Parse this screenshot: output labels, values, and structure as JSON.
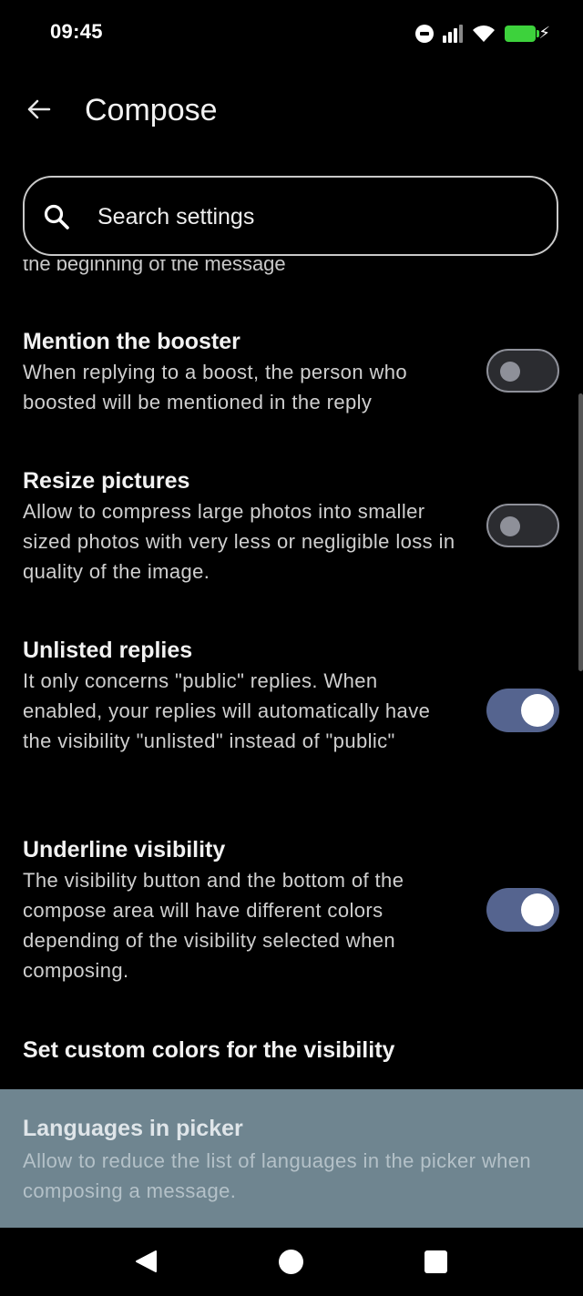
{
  "status_bar": {
    "time": "09:45"
  },
  "app_bar": {
    "title": "Compose"
  },
  "search": {
    "placeholder": "Search settings"
  },
  "clipped_previous_desc": "the beginning of the message",
  "settings": [
    {
      "title": "Mention the booster",
      "desc": "When replying to a boost, the person who boosted will be mentioned in the reply",
      "toggle": false
    },
    {
      "title": "Resize pictures",
      "desc": "Allow to compress large photos into smaller sized photos with very less or negligible loss in quality of the image.",
      "toggle": false
    },
    {
      "title": "Unlisted replies",
      "desc": "It only concerns \"public\" replies. When enabled, your replies will automatically have the visibility \"unlisted\" instead of \"public\"",
      "toggle": true
    },
    {
      "title": "Underline visibility",
      "desc": "The visibility button and the bottom of the compose area will have different colors depending of the visibility selected when composing.",
      "toggle": true
    },
    {
      "title": "Set custom colors for the visibility"
    },
    {
      "title": "Languages in picker",
      "desc": "Allow to reduce the list of languages in the picker when composing a message."
    }
  ],
  "colors": {
    "toggle_on": "#55648f",
    "highlight": "#6f8590"
  }
}
